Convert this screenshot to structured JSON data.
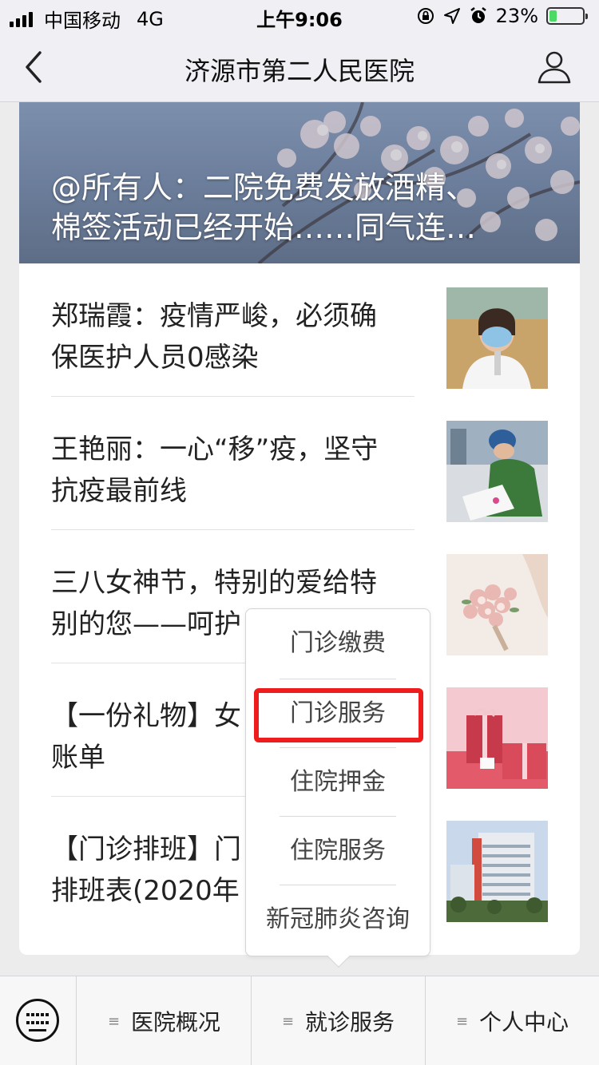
{
  "status_bar": {
    "carrier": "中国移动",
    "network": "4G",
    "time": "上午9:06",
    "battery": "23%",
    "battery_level": 0.23
  },
  "nav": {
    "title": "济源市第二人民医院",
    "icons": [
      "back-chevron-icon",
      "user-icon"
    ]
  },
  "hero": {
    "title": "@所有人：二院免费发放酒精、\n棉签活动已经开始……同气连…"
  },
  "articles": [
    {
      "title": "郑瑞霞：疫情严峻，必须确\n保医护人员0感染",
      "thumb": "doctor-with-mask-photo"
    },
    {
      "title": "王艳丽：一心“移”疫，坚守\n抗疫最前线",
      "thumb": "nurse-signing-form-photo"
    },
    {
      "title": "三八女神节，特别的爱给特\n别的您——呵护",
      "thumb": "flower-bouquet-photo"
    },
    {
      "title": "【一份礼物】女\n账单",
      "thumb": "gift-boxes-photo"
    },
    {
      "title": "【门诊排班】门\n排班表(2020年",
      "thumb": "hospital-building-photo"
    }
  ],
  "popup_menu": {
    "items": [
      "门诊缴费",
      "门诊服务",
      "住院押金",
      "住院服务",
      "新冠肺炎咨询"
    ],
    "highlighted": "门诊服务",
    "highlight_color": "#ee1c1c"
  },
  "tabbar": {
    "tabs": [
      "医院概况",
      "就诊服务",
      "个人中心"
    ],
    "menu_icon_glyph": "≡",
    "keyboard_icon": "keyboard-icon"
  }
}
